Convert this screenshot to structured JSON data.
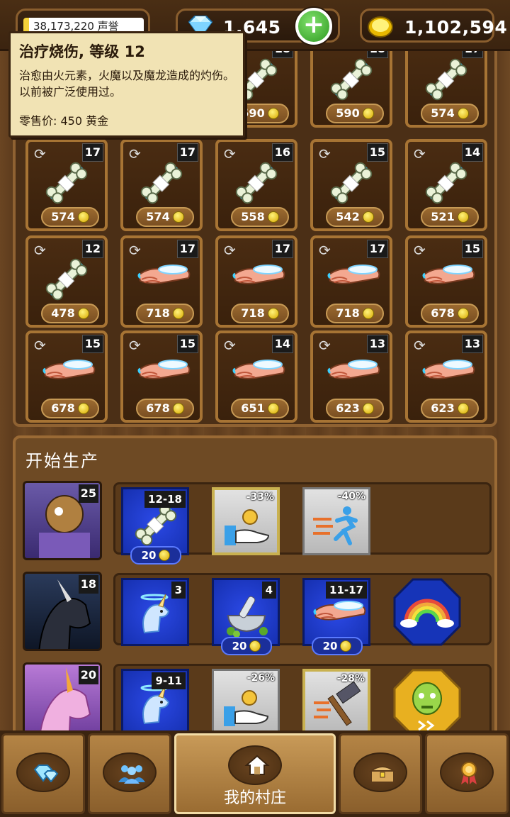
{
  "resources": {
    "fame": "38,173,220 声誉",
    "gems": "1,645",
    "gold": "1,102,594"
  },
  "tooltip": {
    "title": "治疗烧伤, 等级 12",
    "description": "治愈由火元素，火魔以及魔龙造成的灼伤。以前被广泛使用过。",
    "price": "零售价: 450 黄金"
  },
  "inventory": [
    {
      "item": "bone-splint",
      "level": "",
      "price": "590"
    },
    {
      "item": "bone-splint",
      "level": "18",
      "price": "590"
    },
    {
      "item": "bone-splint",
      "level": "18",
      "price": "590"
    },
    {
      "item": "bone-splint",
      "level": "17",
      "price": "574"
    },
    {
      "item": "bone-splint",
      "level": "17",
      "price": "574"
    },
    {
      "item": "bone-splint",
      "level": "17",
      "price": "574"
    },
    {
      "item": "bone-splint",
      "level": "16",
      "price": "558"
    },
    {
      "item": "bone-splint",
      "level": "15",
      "price": "542"
    },
    {
      "item": "bone-splint",
      "level": "14",
      "price": "521"
    },
    {
      "item": "bone-splint",
      "level": "12",
      "price": "478"
    },
    {
      "item": "burn-arm",
      "level": "17",
      "price": "718"
    },
    {
      "item": "burn-arm",
      "level": "17",
      "price": "718"
    },
    {
      "item": "burn-arm",
      "level": "17",
      "price": "718"
    },
    {
      "item": "burn-arm",
      "level": "15",
      "price": "678"
    },
    {
      "item": "burn-arm",
      "level": "15",
      "price": "678"
    },
    {
      "item": "burn-arm",
      "level": "15",
      "price": "678"
    },
    {
      "item": "burn-arm",
      "level": "14",
      "price": "651"
    },
    {
      "item": "burn-arm",
      "level": "13",
      "price": "623"
    },
    {
      "item": "burn-arm",
      "level": "13",
      "price": "623"
    }
  ],
  "production": {
    "title": "开始生产",
    "workers": [
      {
        "level": "25",
        "tasks": [
          {
            "kind": "task",
            "icon": "bone-splint",
            "label": "12-18",
            "cost": "20"
          },
          {
            "kind": "boost",
            "icon": "hand-coin-icon",
            "pct": "-33%",
            "selected": true
          },
          {
            "kind": "boost",
            "icon": "running-man-icon",
            "pct": "-40%",
            "selected": false
          }
        ]
      },
      {
        "level": "18",
        "tasks": [
          {
            "kind": "task",
            "icon": "unicorn-icon",
            "label": "3",
            "cost": ""
          },
          {
            "kind": "task",
            "icon": "mortar-pestle-icon",
            "label": "4",
            "cost": "20"
          },
          {
            "kind": "task",
            "icon": "burn-arm",
            "label": "11-17",
            "cost": "20"
          },
          {
            "kind": "special",
            "icon": "rainbow-icon"
          }
        ]
      },
      {
        "level": "20",
        "tasks": [
          {
            "kind": "task",
            "icon": "unicorn-icon",
            "label": "9-11",
            "cost": ""
          },
          {
            "kind": "boost",
            "icon": "hand-coin-icon",
            "pct": "-26%",
            "selected": false
          },
          {
            "kind": "boost",
            "icon": "hammer-icon",
            "pct": "-28%",
            "selected": true
          },
          {
            "kind": "special",
            "icon": "zombie-icon"
          }
        ]
      }
    ]
  },
  "nav": {
    "village_label": "我的村庄"
  },
  "colors": {
    "wood": "#6e4a24",
    "task_blue": "#2b49e6",
    "gold": "#f4d23a"
  }
}
